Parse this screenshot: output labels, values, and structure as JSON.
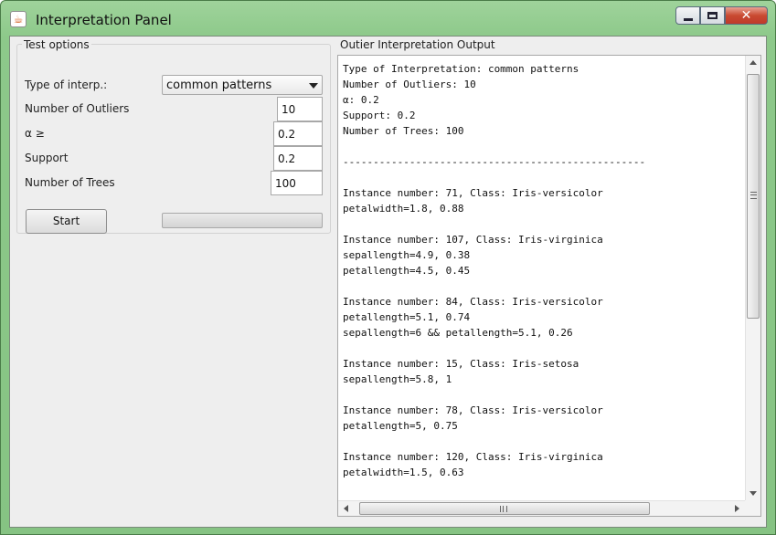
{
  "window": {
    "title": "Interpretation Panel",
    "minimize_icon": "minimize-icon",
    "maximize_icon": "maximize-icon",
    "close_icon": "close-icon",
    "close_glyph": "✕",
    "app_icon": "java-icon",
    "app_glyph": "☕"
  },
  "test_options": {
    "legend": "Test options",
    "type_label": "Type of interp.:",
    "type_value": "common patterns",
    "outliers_label": "Number of Outliers",
    "outliers_value": "10",
    "alpha_label": "α ≥",
    "alpha_value": "0.2",
    "support_label": "Support",
    "support_value": "0.2",
    "trees_label": "Number of Trees",
    "trees_value": "100",
    "start_label": "Start",
    "progress": 0
  },
  "output": {
    "title": "Outier Interpretation Output",
    "lines": [
      "Type of Interpretation: common patterns",
      "Number of Outliers: 10",
      "α: 0.2",
      "Support: 0.2",
      "Number of Trees: 100",
      "",
      "--------------------------------------------------",
      "",
      "Instance number: 71, Class: Iris-versicolor",
      "petalwidth=1.8, 0.88",
      "",
      "Instance number: 107, Class: Iris-virginica",
      "sepallength=4.9, 0.38",
      "petallength=4.5, 0.45",
      "",
      "Instance number: 84, Class: Iris-versicolor",
      "petallength=5.1, 0.74",
      "sepallength=6 && petallength=5.1, 0.26",
      "",
      "Instance number: 15, Class: Iris-setosa",
      "sepallength=5.8, 1",
      "",
      "Instance number: 78, Class: Iris-versicolor",
      "petallength=5, 0.75",
      "",
      "Instance number: 120, Class: Iris-virginica",
      "petalwidth=1.5, 0.63"
    ]
  }
}
